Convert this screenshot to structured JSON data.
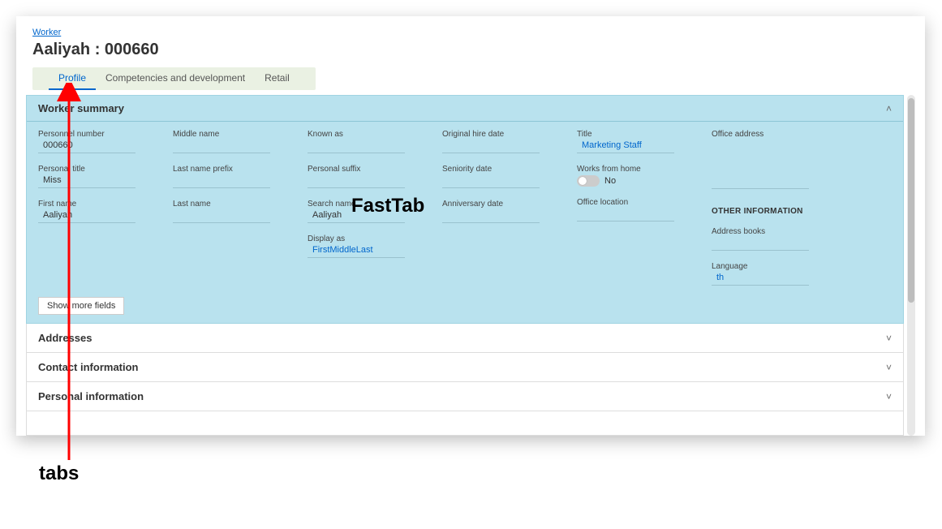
{
  "breadcrumb": "Worker",
  "page_title": "Aaliyah : 000660",
  "tabs": [
    {
      "label": "Profile",
      "active": true
    },
    {
      "label": "Competencies and development",
      "active": false
    },
    {
      "label": "Retail",
      "active": false
    }
  ],
  "fasttab": {
    "title": "Worker summary",
    "overlay": "FastTab",
    "col1": {
      "personnel_number": {
        "label": "Personnel number",
        "value": "000660"
      },
      "personal_title": {
        "label": "Personal title",
        "value": "Miss"
      },
      "first_name": {
        "label": "First name",
        "value": "Aaliyah"
      }
    },
    "col2": {
      "middle_name": {
        "label": "Middle name",
        "value": ""
      },
      "last_name_prefix": {
        "label": "Last name prefix",
        "value": ""
      },
      "last_name": {
        "label": "Last name",
        "value": ""
      }
    },
    "col3": {
      "known_as": {
        "label": "Known as",
        "value": ""
      },
      "personal_suffix": {
        "label": "Personal suffix",
        "value": ""
      },
      "search_name": {
        "label": "Search name",
        "value": "Aaliyah"
      },
      "display_as": {
        "label": "Display as",
        "value": "FirstMiddleLast"
      }
    },
    "col4": {
      "original_hire_date": {
        "label": "Original hire date",
        "value": ""
      },
      "seniority_date": {
        "label": "Seniority date",
        "value": ""
      },
      "anniversary_date": {
        "label": "Anniversary date",
        "value": ""
      }
    },
    "col5": {
      "title": {
        "label": "Title",
        "value": "Marketing Staff"
      },
      "works_from_home": {
        "label": "Works from home",
        "value": "No"
      },
      "office_location": {
        "label": "Office location",
        "value": ""
      }
    },
    "col6": {
      "office_address": {
        "label": "Office address",
        "value": ""
      },
      "other_info_header": "OTHER INFORMATION",
      "address_books": {
        "label": "Address books",
        "value": ""
      },
      "language": {
        "label": "Language",
        "value": "th"
      }
    },
    "show_more": "Show more fields"
  },
  "collapsed": [
    {
      "title": "Addresses"
    },
    {
      "title": "Contact information"
    },
    {
      "title": "Personal information"
    }
  ],
  "annotations": {
    "tabs_label": "tabs"
  }
}
